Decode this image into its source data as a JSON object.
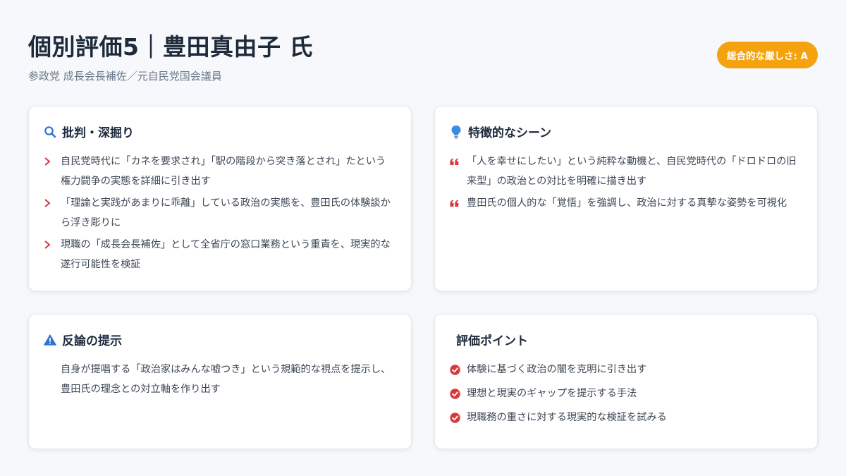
{
  "header": {
    "title": "個別評価5｜豊田真由子 氏",
    "subtitle": "参政党 成長会長補佐／元自民党国会議員",
    "badge": "総合的な厳しさ: A"
  },
  "colors": {
    "accent": "#f5a20f",
    "danger": "#d9383a",
    "info": "#2f76d2"
  },
  "cards": {
    "critique": {
      "icon": "search-icon",
      "title": "批判・深掘り",
      "items": [
        "自民党時代に「カネを要求され」「駅の階段から突き落とされ」たという権力闘争の実態を詳細に引き出す",
        "「理論と実践があまりに乖離」している政治の実態を、豊田氏の体験談から浮き彫りに",
        "現職の「成長会長補佐」として全省庁の窓口業務という重責を、現実的な遂行可能性を検証"
      ]
    },
    "scene": {
      "icon": "lightbulb-icon",
      "title": "特徴的なシーン",
      "items": [
        "「人を幸せにしたい」という純粋な動機と、自民党時代の「ドロドロの旧来型」の政治との対比を明確に描き出す",
        "豊田氏の個人的な「覚悟」を強調し、政治に対する真摯な姿勢を可視化"
      ]
    },
    "counter": {
      "icon": "warning-icon",
      "title": "反論の提示",
      "text": "自身が提唱する「政治家はみんな嘘つき」という規範的な視点を提示し、豊田氏の理念との対立軸を作り出す"
    },
    "evaluation": {
      "title": "評価ポイント",
      "items": [
        "体験に基づく政治の闇を克明に引き出す",
        "理想と現実のギャップを提示する手法",
        "現職務の重さに対する現実的な検証を試みる"
      ]
    }
  }
}
